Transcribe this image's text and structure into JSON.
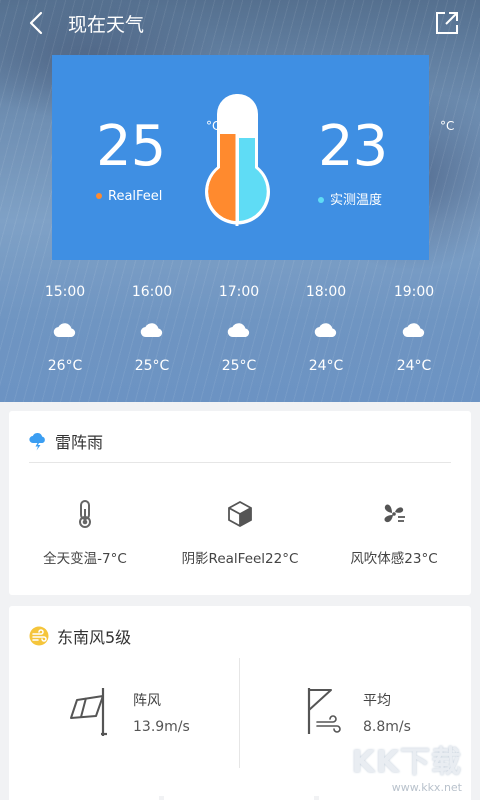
{
  "header": {
    "title": "现在天气"
  },
  "temp_card": {
    "realfeel": {
      "value": "25",
      "unit": "°C",
      "label": "RealFeel",
      "color": "#ff8a2e"
    },
    "measured": {
      "value": "23",
      "unit": "°C",
      "label": "实测温度",
      "color": "#5fdcf5"
    }
  },
  "hourly": [
    {
      "time": "15:00",
      "icon": "cloudy-icon",
      "temp": "26°C"
    },
    {
      "time": "16:00",
      "icon": "cloudy-icon",
      "temp": "25°C"
    },
    {
      "time": "17:00",
      "icon": "cloudy-icon",
      "temp": "25°C"
    },
    {
      "time": "18:00",
      "icon": "cloudy-icon",
      "temp": "24°C"
    },
    {
      "time": "19:00",
      "icon": "cloudy-icon",
      "temp": "24°C"
    }
  ],
  "condition_card": {
    "title": "雷阵雨",
    "icon": "thunderstorm-icon",
    "stats": [
      {
        "icon": "thermometer-icon",
        "text": "全天变温-7°C"
      },
      {
        "icon": "shade-cube-icon",
        "text": "阴影RealFeel22°C"
      },
      {
        "icon": "fan-icon",
        "text": "风吹体感23°C"
      }
    ]
  },
  "wind_card": {
    "title": "东南风5级",
    "icon": "wind-icon",
    "gust": {
      "label": "阵风",
      "value": "13.9m/s",
      "icon": "windsock-icon"
    },
    "average": {
      "label": "平均",
      "value": "8.8m/s",
      "icon": "flag-wind-icon"
    }
  },
  "watermark": {
    "logo": "KK下载",
    "url": "www.kkx.net"
  },
  "colors": {
    "card_blue": "#3f8fe3",
    "accent_orange": "#ff8a2e",
    "accent_cyan": "#5fdcf5",
    "icon_yellow": "#f5c53b",
    "icon_blue": "#3b9ef2"
  }
}
